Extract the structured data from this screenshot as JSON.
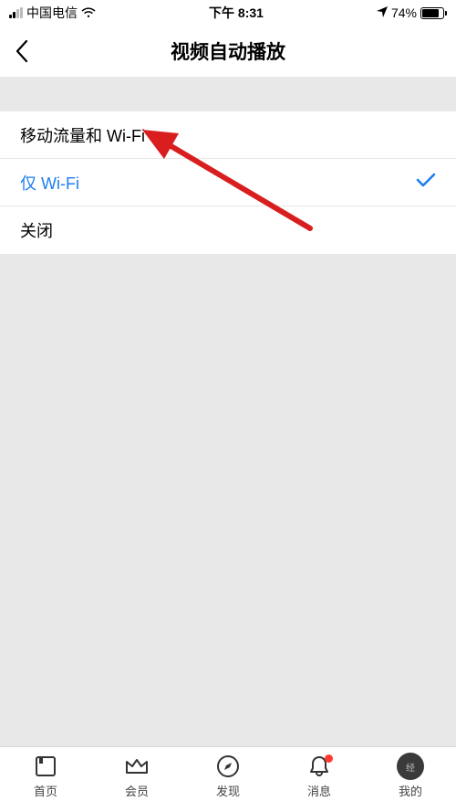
{
  "status": {
    "carrier": "中国电信",
    "time": "下午 8:31",
    "battery_pct": "74%"
  },
  "header": {
    "title": "视频自动播放"
  },
  "options": [
    {
      "label": "移动流量和 Wi-Fi",
      "selected": false
    },
    {
      "label": "仅 Wi-Fi",
      "selected": true
    },
    {
      "label": "关闭",
      "selected": false
    }
  ],
  "tabs": [
    {
      "label": "首页"
    },
    {
      "label": "会员"
    },
    {
      "label": "发现"
    },
    {
      "label": "消息"
    },
    {
      "label": "我的"
    }
  ],
  "annotation": {
    "type": "arrow",
    "color": "#d81e1e"
  }
}
